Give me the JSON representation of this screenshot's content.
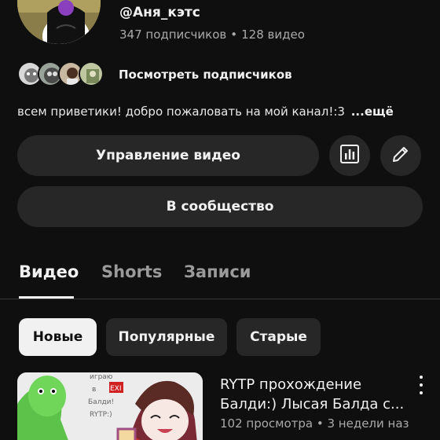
{
  "channel": {
    "handle": "@Аня_кэтс",
    "subscribers": "347 подписчиков",
    "separator": "•",
    "videos": "128 видео",
    "view_subscribers_label": "Посмотреть подписчиков",
    "description": "всем приветики! добро пожаловать на мой канал!:3",
    "more_label": "...ещё"
  },
  "actions": {
    "manage_videos": "Управление видео",
    "community": "В сообщество",
    "stats_icon": "analytics-icon",
    "edit_icon": "pencil-icon"
  },
  "tabs": [
    {
      "label": "Видео",
      "active": true
    },
    {
      "label": "Shorts",
      "active": false
    },
    {
      "label": "Записи",
      "active": false
    }
  ],
  "filters": [
    {
      "label": "Новые",
      "selected": true
    },
    {
      "label": "Популярные",
      "selected": false
    },
    {
      "label": "Старые",
      "selected": false
    }
  ],
  "video": {
    "title": "RYTP прохождение Балди:) Лысая Балда с...",
    "meta": "102 просмотра • 3 недели наз...",
    "thumb_text": [
      "игрaю",
      "в",
      "Балди!",
      "RYTP:)"
    ],
    "thumb_badge": "EXI"
  },
  "colors": {
    "background": "#0f0f0f",
    "surface": "#272727",
    "text_primary": "#f1f1f1",
    "text_secondary": "#aaaaaa"
  }
}
